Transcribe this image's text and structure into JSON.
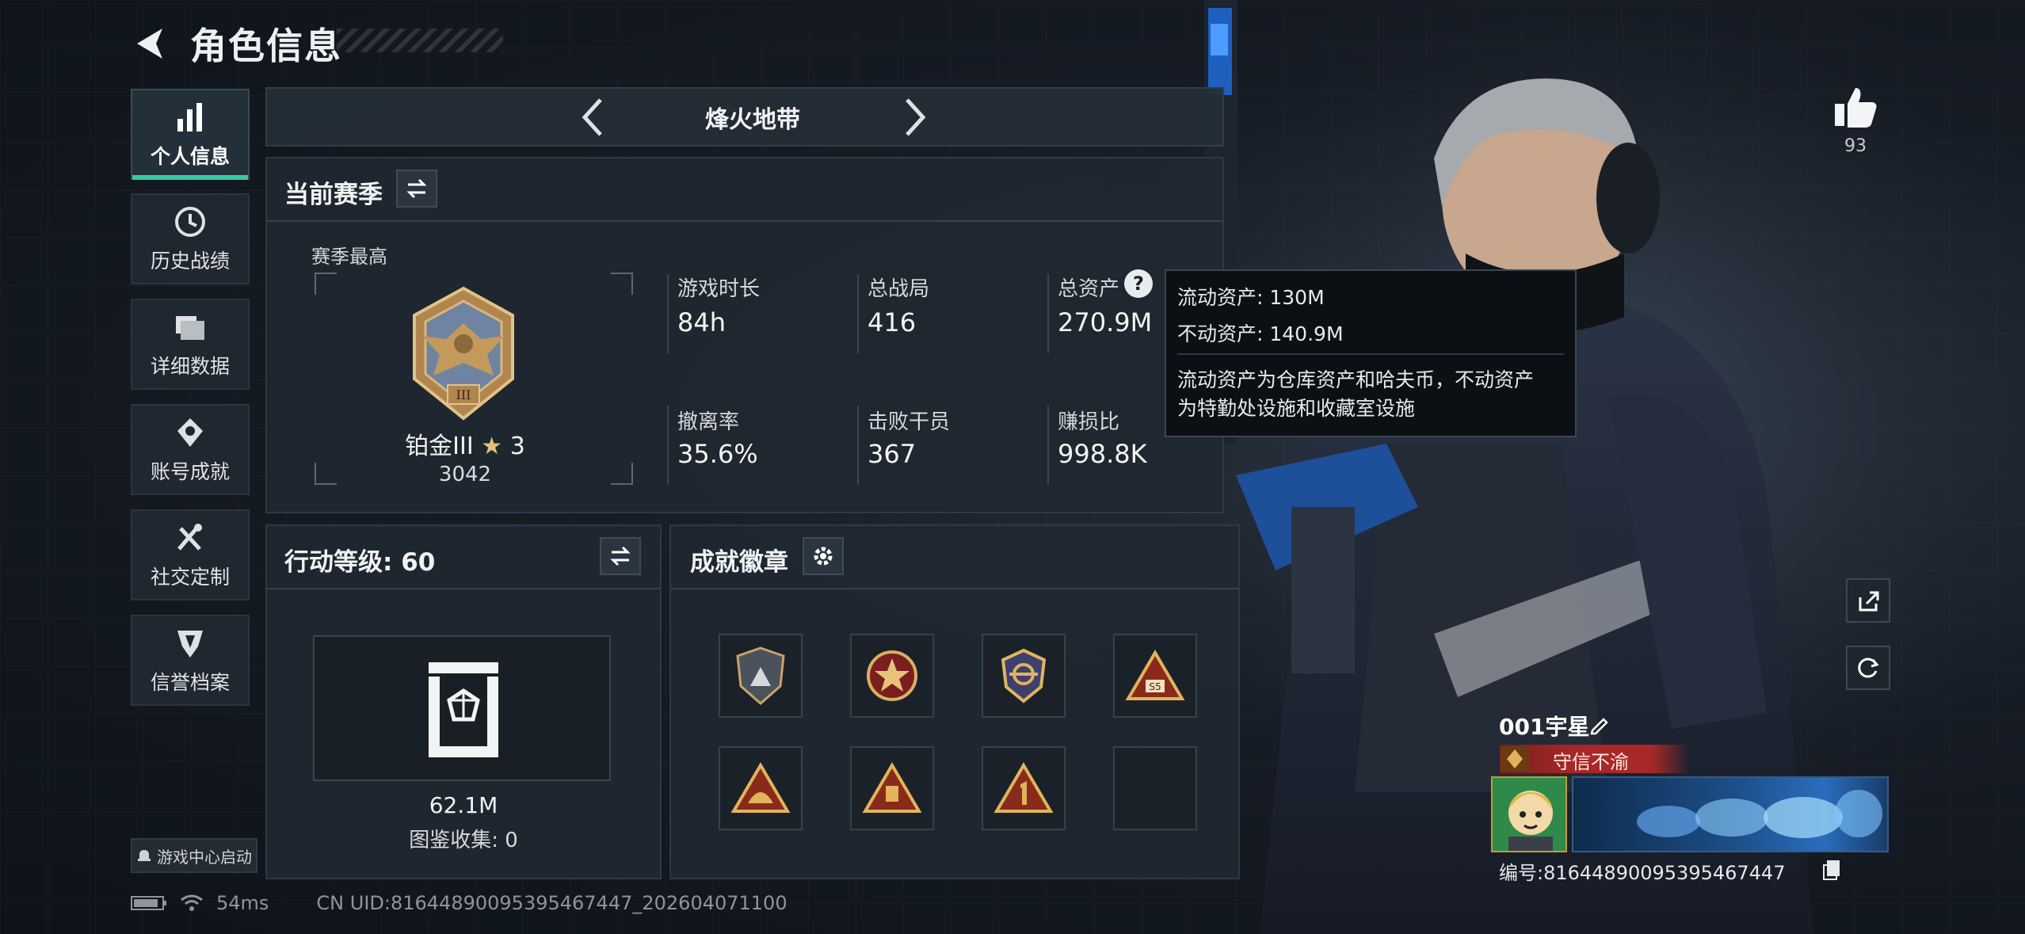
{
  "header": {
    "title": "角色信息"
  },
  "sidebar": {
    "items": [
      {
        "label": "个人信息",
        "icon": "bar-chart-icon",
        "active": true
      },
      {
        "label": "历史战绩",
        "icon": "clock-icon",
        "active": false
      },
      {
        "label": "详细数据",
        "icon": "folder-icon",
        "active": false
      },
      {
        "label": "账号成就",
        "icon": "achievement-icon",
        "active": false
      },
      {
        "label": "社交定制",
        "icon": "tools-icon",
        "active": false
      },
      {
        "label": "信誉档案",
        "icon": "shield-icon",
        "active": false
      }
    ],
    "launcher": "游戏中心启动"
  },
  "mode": {
    "title": "烽火地带"
  },
  "season": {
    "title": "当前赛季",
    "best_label": "赛季最高",
    "rank_name": "铂金III",
    "rank_stars": "3",
    "rank_score": "3042",
    "stats": [
      {
        "label": "游戏时长",
        "value": "84h"
      },
      {
        "label": "总战局",
        "value": "416"
      },
      {
        "label": "总资产",
        "value": "270.9M"
      },
      {
        "label": "撤离率",
        "value": "35.6%"
      },
      {
        "label": "击败干员",
        "value": "367"
      },
      {
        "label": "赚损比",
        "value": "998.8K"
      }
    ]
  },
  "tooltip": {
    "line1": "流动资产: 130M",
    "line2": "不动资产: 140.9M",
    "desc1": "流动资产为仓库资产和哈夫币，不动资产",
    "desc2": "为特勤处设施和收藏室设施"
  },
  "level": {
    "title": "行动等级: 60",
    "value": "62.1M",
    "collection": "图鉴收集: 0"
  },
  "badges": {
    "title": "成就徽章",
    "slots": 8
  },
  "profile": {
    "likes": "93",
    "name": "001宇星",
    "title_tag": "守信不渝",
    "uid_label": "编号:8164489009539546​7447"
  },
  "status": {
    "ping": "54ms",
    "uid": "CN UID:8164489009539546​7447_202604071100"
  },
  "colors": {
    "accent": "#36c9a7",
    "tag_red": "#a82828",
    "panel": "#202831"
  }
}
